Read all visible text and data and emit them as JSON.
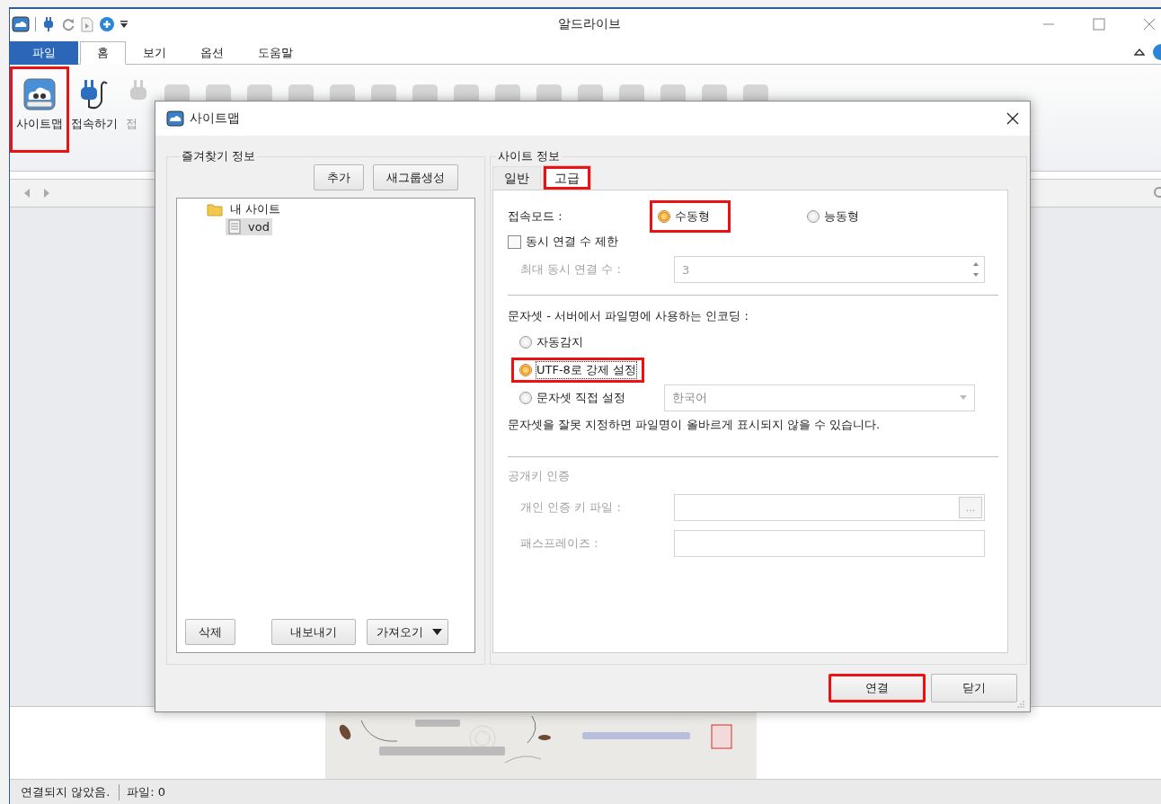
{
  "window": {
    "title": "알드라이브"
  },
  "ribbon_tabs": [
    {
      "label": "파일",
      "kind": "file",
      "selected": false
    },
    {
      "label": "홈",
      "kind": "tab",
      "selected": true
    },
    {
      "label": "보기",
      "kind": "tab",
      "selected": false
    },
    {
      "label": "옵션",
      "kind": "tab",
      "selected": false
    },
    {
      "label": "도움말",
      "kind": "tab",
      "selected": false
    }
  ],
  "ribbon_buttons": [
    {
      "label": "사이트맵",
      "kind": "sitemap",
      "disabled": false,
      "highlighted": true
    },
    {
      "label": "접속하기",
      "kind": "connect",
      "disabled": false,
      "highlighted": false
    },
    {
      "label": "접",
      "kind": "disconnect",
      "disabled": true,
      "highlighted": false
    }
  ],
  "dialog": {
    "title": "사이트맵",
    "favorites": {
      "title": "즐겨찾기 정보",
      "top_buttons": [
        "추가",
        "새그룹생성"
      ],
      "tree": [
        {
          "label": "내 사이트",
          "kind": "folder",
          "selected": false,
          "children": [
            {
              "label": "vod",
              "kind": "site",
              "selected": true
            }
          ]
        }
      ],
      "bottom_buttons": [
        {
          "label": "삭제",
          "dropdown": false
        },
        {
          "label": "내보내기",
          "dropdown": false
        },
        {
          "label": "가져오기",
          "dropdown": true
        }
      ]
    },
    "site_info": {
      "title": "사이트 정보",
      "tabs": [
        {
          "label": "일반",
          "selected": false,
          "highlighted": false
        },
        {
          "label": "고급",
          "selected": true,
          "highlighted": true
        }
      ],
      "connection_mode": {
        "label": "접속모드 :",
        "options": [
          {
            "label": "수동형",
            "selected": true,
            "highlighted": true
          },
          {
            "label": "능동형",
            "selected": false,
            "highlighted": false
          }
        ]
      },
      "limit_connections": {
        "label": "동시 연결 수 제한",
        "checked": false
      },
      "max_connections": {
        "label": "최대 동시 연결 수 :",
        "value": "3",
        "disabled": true
      },
      "charset": {
        "label": "문자셋 - 서버에서 파일명에 사용하는 인코딩 :",
        "options": [
          {
            "label": "자동감지",
            "selected": false,
            "highlighted": false
          },
          {
            "label": "UTF-8로 강제 설정",
            "selected": true,
            "highlighted": true
          },
          {
            "label": "문자셋 직접 설정",
            "selected": false,
            "highlighted": false
          }
        ],
        "select_value": "한국어",
        "select_disabled": true,
        "note": "문자셋을 잘못 지정하면 파일명이 올바르게 표시되지 않을 수 있습니다."
      },
      "public_key": {
        "title": "공개키 인증",
        "disabled": true,
        "fields": [
          {
            "label": "개인 인증 키 파일 :",
            "browse_label": "..."
          },
          {
            "label": "패스프레이즈 :"
          }
        ]
      }
    },
    "buttons": [
      {
        "label": "연결",
        "highlighted": true
      },
      {
        "label": "닫기",
        "highlighted": false
      }
    ]
  },
  "status_bar": [
    "연결되지 않았음.",
    "파일: 0"
  ]
}
